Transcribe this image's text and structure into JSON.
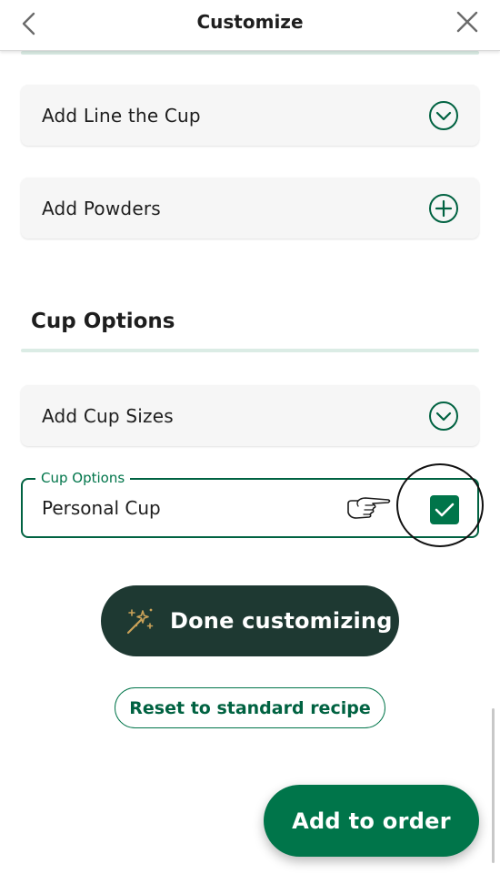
{
  "header": {
    "title": "Customize",
    "back_icon": "chevron-left-icon",
    "close_icon": "close-icon"
  },
  "options": [
    {
      "label": "Add Line the Cup",
      "icon": "chevron-down-circle-icon"
    },
    {
      "label": "Add Powders",
      "icon": "plus-circle-icon"
    }
  ],
  "cup_section": {
    "title": "Cup Options",
    "sizes": {
      "label": "Add Cup Sizes",
      "icon": "chevron-down-circle-icon"
    },
    "field": {
      "legend": "Cup Options",
      "value": "Personal Cup",
      "checked": true
    }
  },
  "actions": {
    "done_label": "Done customizing",
    "reset_label": "Reset to standard recipe",
    "add_label": "Add to order"
  },
  "colors": {
    "brand_green": "#00754a",
    "dark_green": "#1e3932",
    "house_green": "#006241",
    "sparkle_gold": "#cba258"
  }
}
